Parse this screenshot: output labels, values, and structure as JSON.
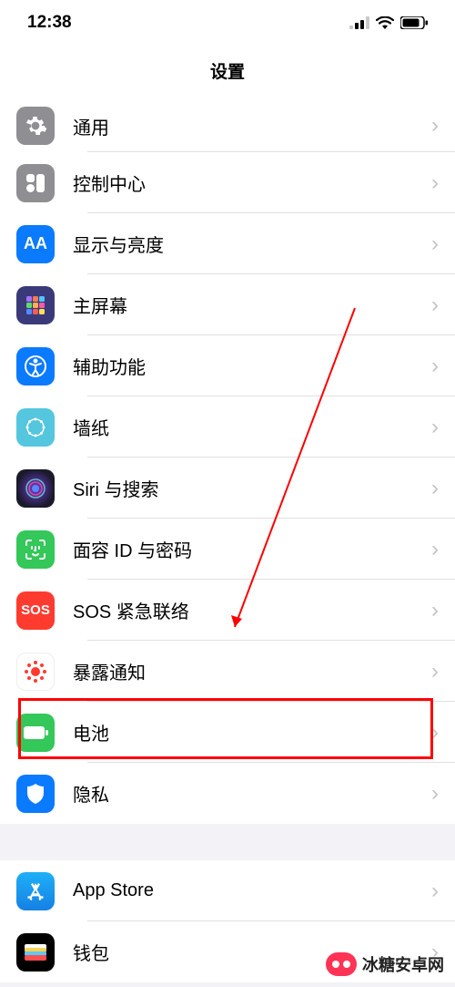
{
  "status": {
    "time": "12:38"
  },
  "title": "设置",
  "group1": [
    {
      "label": "通用",
      "icon": "general",
      "bg": "#8e8e93"
    },
    {
      "label": "控制中心",
      "icon": "control",
      "bg": "#8e8e93"
    },
    {
      "label": "显示与亮度",
      "icon": "display",
      "bg": "#0a7aff"
    },
    {
      "label": "主屏幕",
      "icon": "home",
      "bg": "#3a3a7a"
    },
    {
      "label": "辅助功能",
      "icon": "accessibility",
      "bg": "#0a7aff"
    },
    {
      "label": "墙纸",
      "icon": "wallpaper",
      "bg": "#54c6de"
    },
    {
      "label": "Siri 与搜索",
      "icon": "siri",
      "bg": "#1a1a2a"
    },
    {
      "label": "面容 ID 与密码",
      "icon": "faceid",
      "bg": "#34c759"
    },
    {
      "label": "SOS 紧急联络",
      "icon": "sos",
      "bg": "#ff3b30"
    },
    {
      "label": "暴露通知",
      "icon": "exposure",
      "bg": "#ffffff"
    },
    {
      "label": "电池",
      "icon": "battery",
      "bg": "#34c759"
    },
    {
      "label": "隐私",
      "icon": "privacy",
      "bg": "#0a7aff"
    }
  ],
  "group2": [
    {
      "label": "App Store",
      "icon": "appstore",
      "bg": "#1e9ef4"
    },
    {
      "label": "钱包",
      "icon": "wallet",
      "bg": "#000000"
    }
  ],
  "watermark": "冰糖安卓网"
}
